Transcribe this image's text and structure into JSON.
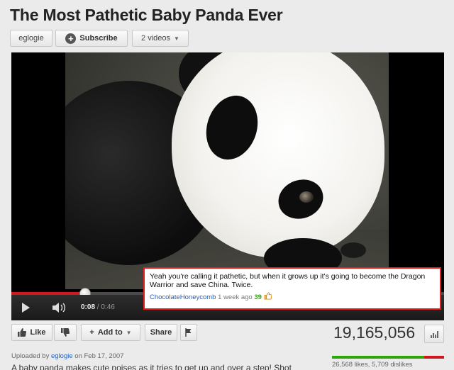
{
  "video": {
    "title": "The Most Pathetic Baby Panda Ever",
    "description": "A baby panda makes cute noises as it tries to get up and over a step! Shot"
  },
  "channel": {
    "name": "eglogie",
    "subscribe_label": "Subscribe",
    "videos_label": "2 videos"
  },
  "player": {
    "current_time": "0:08",
    "duration": "/ 0:46",
    "progress_fraction": 0.17
  },
  "annotation": {
    "text": "Yeah you're calling it pathetic, but when it grows up it's going to become the Dragon Warrior and save China. Twice.",
    "author": "ChocolateHoneycomb",
    "age": "1 week ago",
    "votes": "39"
  },
  "actions": {
    "like_label": "Like",
    "add_to_label": "Add to",
    "share_label": "Share"
  },
  "stats": {
    "views": "19,165,056",
    "likes_dislikes": "26,568 likes, 5,709 dislikes",
    "likes_fraction": 0.82
  },
  "upload": {
    "prefix": "Uploaded by",
    "uploader": "eglogie",
    "date": "on Feb 17, 2007"
  },
  "colors": {
    "accent_red": "#cc181e",
    "like_green": "#2ca60b",
    "link_blue": "#2760b8"
  }
}
